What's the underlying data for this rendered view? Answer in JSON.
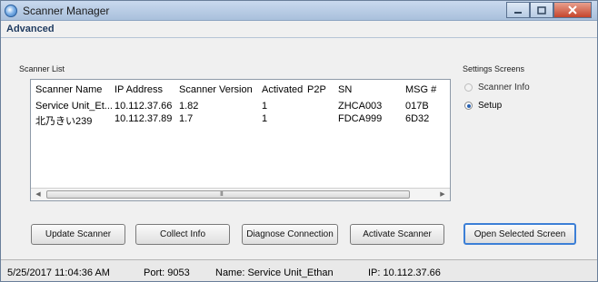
{
  "window": {
    "title": "Scanner Manager"
  },
  "section": {
    "title": "Advanced"
  },
  "scanner_list": {
    "label": "Scanner List",
    "columns": [
      "Scanner Name",
      "IP Address",
      "Scanner Version",
      "Activated",
      "P2P",
      "SN",
      "MSG #"
    ],
    "rows": [
      [
        "Service Unit_Et...",
        "10.112.37.66",
        "1.82",
        "1",
        "",
        "ZHCA003",
        "017B"
      ],
      [
        "北乃きい239",
        "10.112.37.89",
        "1.7",
        "1",
        "",
        "FDCA999",
        "6D32"
      ]
    ],
    "scroll_grip": "III"
  },
  "settings": {
    "label": "Settings Screens",
    "options": [
      {
        "label": "Scanner Info",
        "selected": false
      },
      {
        "label": "Setup",
        "selected": true
      }
    ]
  },
  "buttons": {
    "update": "Update Scanner",
    "collect": "Collect Info",
    "diagnose": "Diagnose Connection",
    "activate": "Activate Scanner",
    "open": "Open Selected Screen"
  },
  "status": {
    "datetime": "5/25/2017 11:04:36 AM",
    "port": "Port: 9053",
    "name": "Name: Service Unit_Ethan",
    "ip": "IP: 10.112.37.66"
  },
  "colors": {
    "accent": "#3c7fd6",
    "title_bar": "#a9c0dc",
    "close_button": "#c5452c"
  }
}
